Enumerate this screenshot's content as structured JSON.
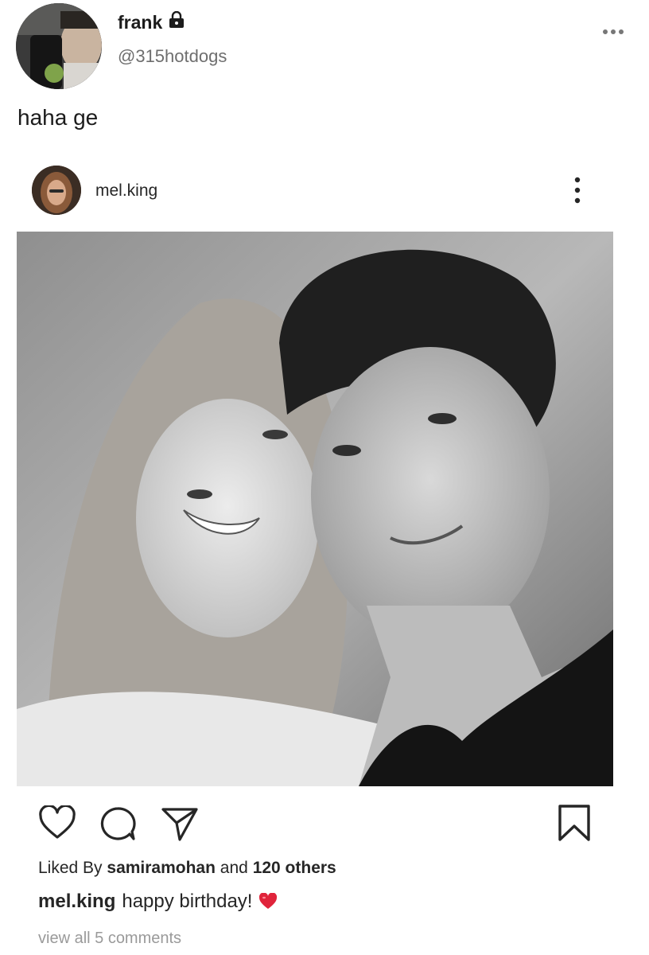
{
  "tweet": {
    "display_name": "frank",
    "handle": "@315hotdogs",
    "text": "haha ge",
    "icons": {
      "verified_lock": "lock-icon",
      "more": "more-horizontal-icon"
    }
  },
  "instagram_post": {
    "username": "mel.king",
    "icons": {
      "more": "more-vertical-icon",
      "like": "heart-icon",
      "comment": "comment-icon",
      "share": "send-icon",
      "save": "bookmark-icon"
    },
    "likes": {
      "prefix": "Liked By",
      "liker": "samiramohan",
      "connector": "and",
      "others": "120 others"
    },
    "caption": {
      "username": "mel.king",
      "text": "happy birthday!",
      "emoji": "heart-emoji"
    },
    "view_comments": "view all 5 comments",
    "colors": {
      "heart_emoji": "#e0243b",
      "text": "#262626",
      "muted": "#9a9a9a"
    }
  }
}
